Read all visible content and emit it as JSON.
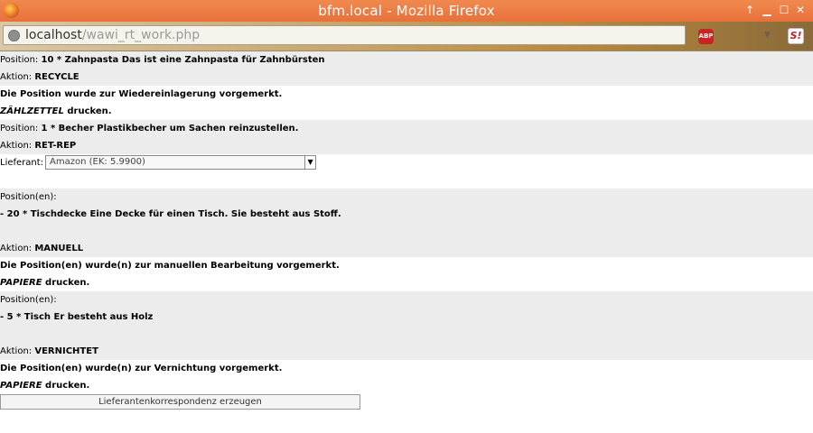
{
  "window": {
    "title": "bfm.local - Mozilla Firefox"
  },
  "navbar": {
    "url_host": "localhost",
    "url_path": "/wawi_rt_work.php",
    "abp_label": "ABP",
    "ext_label": "S!"
  },
  "content": {
    "block1": {
      "position_label": "Position:",
      "position_value": "10 * Zahnpasta Das ist eine Zahnpasta für Zahnbürsten",
      "action_label": "Aktion:",
      "action_value": "RECYCLE",
      "message": "Die Position wurde zur Wiedereinlagerung vorgemerkt.",
      "print_doc": "ZÄHLZETTEL",
      "print_suffix": " drucken."
    },
    "block2": {
      "position_label": "Position:",
      "position_value": "1 * Becher Plastikbecher um Sachen reinzustellen.",
      "action_label": "Aktion:",
      "action_value": "RET-REP",
      "supplier_label": "Lieferant:",
      "supplier_selected": "Amazon (EK: 5.9900)"
    },
    "block3": {
      "positions_label": "Position(en):",
      "positions_item": "- 20 * Tischdecke Eine Decke für einen Tisch. Sie besteht aus Stoff.",
      "action_label": "Aktion:",
      "action_value": "MANUELL",
      "message": "Die Position(en) wurde(n) zur manuellen Bearbeitung vorgemerkt.",
      "print_doc": "PAPIERE",
      "print_suffix": " drucken."
    },
    "block4": {
      "positions_label": "Position(en):",
      "positions_item": "- 5 * Tisch Er besteht aus Holz",
      "action_label": "Aktion:",
      "action_value": "VERNICHTET",
      "message": "Die Position(en) wurde(n) zur Vernichtung vorgemerkt.",
      "print_doc": "PAPIERE",
      "print_suffix": " drucken."
    },
    "button_label": "Lieferantenkorrespondenz erzeugen"
  }
}
